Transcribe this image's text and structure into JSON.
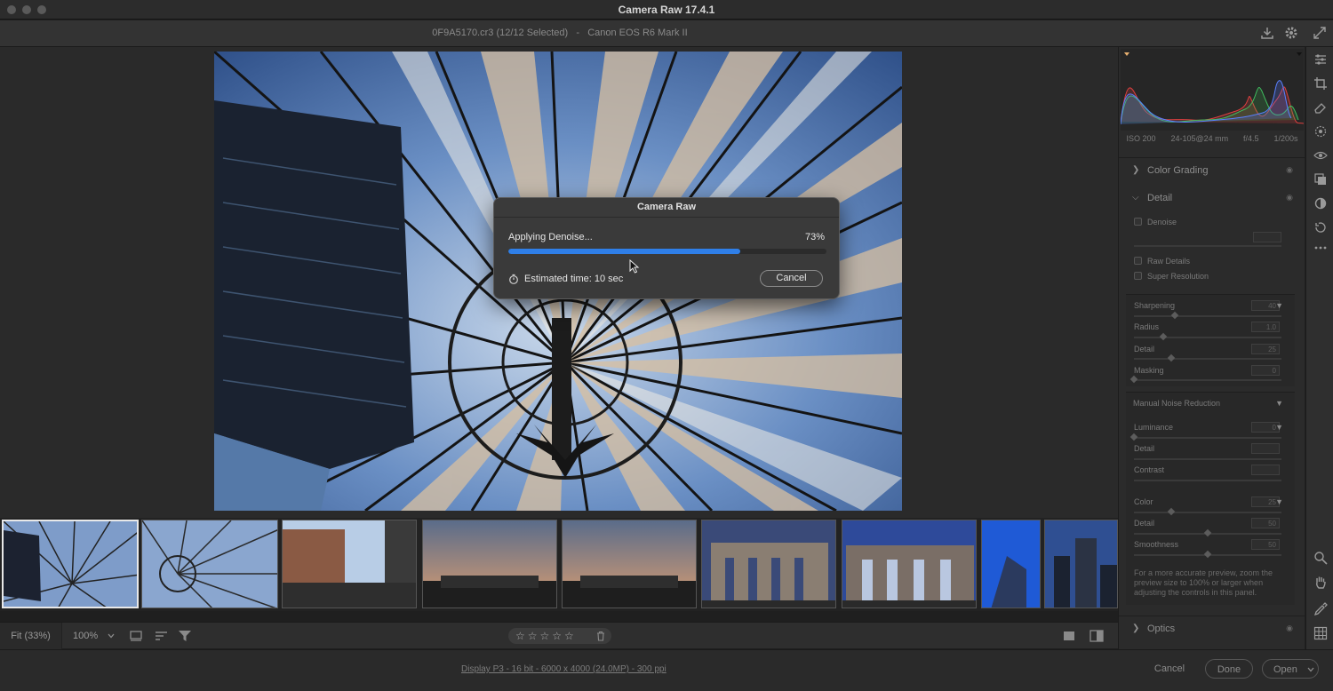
{
  "window": {
    "title": "Camera Raw 17.4.1"
  },
  "file": {
    "name": "0F9A5170.cr3 (12/12 Selected)",
    "separator": "-",
    "camera": "Canon EOS R6 Mark II"
  },
  "dialog": {
    "title": "Camera Raw",
    "message": "Applying Denoise...",
    "percent_label": "73%",
    "progress": 0.73,
    "estimated_time": "Estimated time: 10 sec",
    "cancel_label": "Cancel"
  },
  "filmstrip": {
    "thumbnail_count": 9,
    "selected_index": 0
  },
  "bottombar": {
    "zoom_fit": "Fit (33%)",
    "zoom_100": "100%",
    "stars": "☆☆☆☆☆"
  },
  "footer": {
    "workflow_link": "Display P3 - 16 bit - 6000 x 4000 (24.0MP) - 300 ppi",
    "cancel": "Cancel",
    "done": "Done",
    "open": "Open"
  },
  "panel": {
    "exif": {
      "iso": "ISO 200",
      "lens": "24-105@24 mm",
      "aperture": "f/4.5",
      "shutter": "1/200s"
    },
    "color_grading": "Color Grading",
    "detail": {
      "title": "Detail",
      "denoise": "Denoise",
      "raw_details": "Raw Details",
      "super_resolution": "Super Resolution",
      "sharpening": {
        "label": "Sharpening",
        "value": "40"
      },
      "radius": {
        "label": "Radius",
        "value": "1.0"
      },
      "detail": {
        "label": "Detail",
        "value": "25"
      },
      "masking": {
        "label": "Masking",
        "value": "0"
      },
      "manual_nr": "Manual Noise Reduction",
      "luminance": {
        "label": "Luminance",
        "value": "0"
      },
      "lum_detail": {
        "label": "Detail",
        "value": ""
      },
      "lum_contrast": {
        "label": "Contrast",
        "value": ""
      },
      "color": {
        "label": "Color",
        "value": "25"
      },
      "color_detail": {
        "label": "Detail",
        "value": "50"
      },
      "smoothness": {
        "label": "Smoothness",
        "value": "50"
      },
      "hint": "For a more accurate preview, zoom the preview size to 100% or larger when adjusting the controls in this panel."
    },
    "optics": "Optics"
  },
  "colors": {
    "accent": "#2f7fe8",
    "background": "#1f1f1f",
    "panel": "#2b2b2b"
  }
}
